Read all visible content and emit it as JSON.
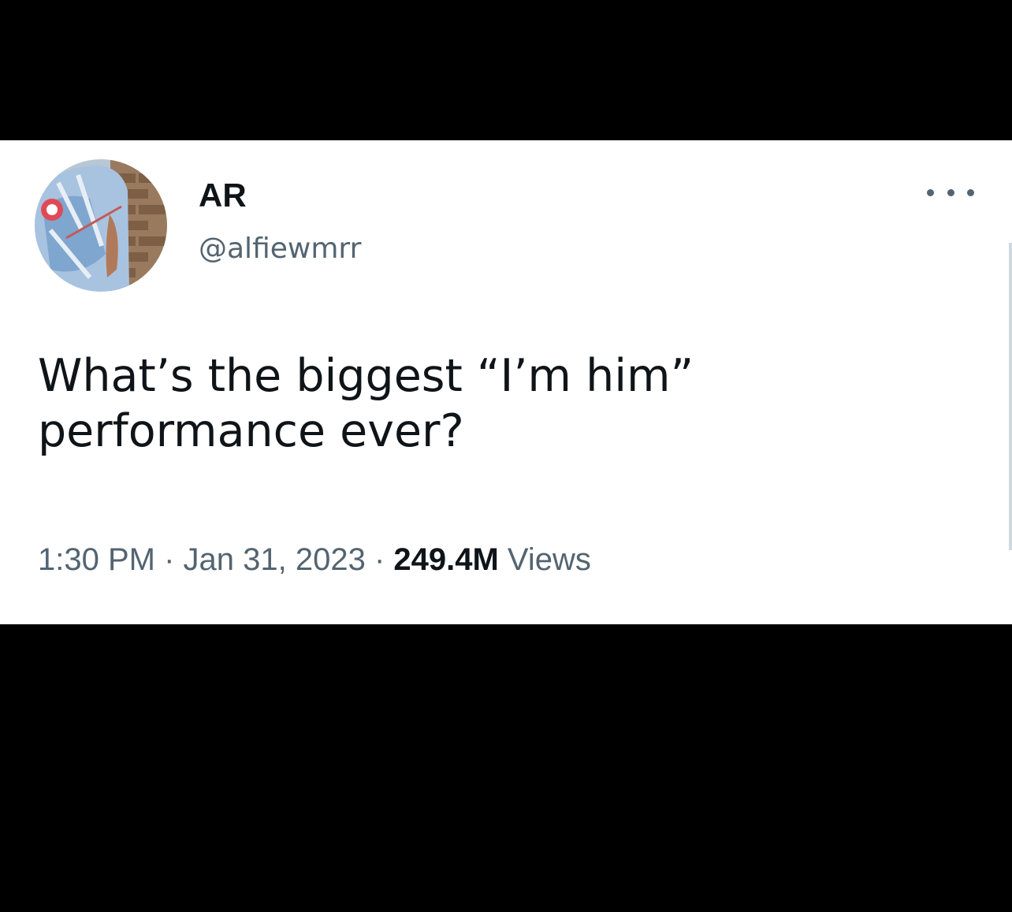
{
  "tweet": {
    "author": {
      "display_name": "AR",
      "handle": "@alfiewmrr",
      "avatar_icon": "profile-photo"
    },
    "more_icon": "more-horizontal-icon",
    "text_lines": [
      "What’s the biggest “I’m him”",
      "performance ever?"
    ],
    "time": "1:30 PM",
    "separator": " · ",
    "date": "Jan 31, 2023",
    "views_count": "249.4M",
    "views_label": "Views"
  },
  "colors": {
    "background": "#000000",
    "card": "#ffffff",
    "primary_text": "#0f1419",
    "secondary_text": "#536471"
  }
}
